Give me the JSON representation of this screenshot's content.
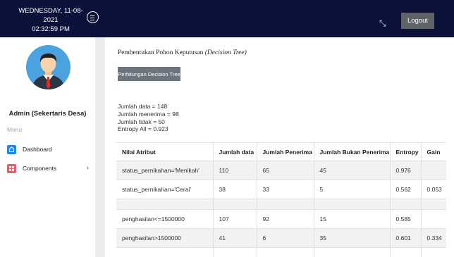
{
  "header": {
    "date": "WEDNESDAY, 11-08-2021",
    "time": "02:32:59 PM",
    "logout_label": "Logout"
  },
  "sidebar": {
    "user_name": "Admin (Sekertaris Desa)",
    "menu_label": "Menu",
    "items": [
      {
        "label": "Dashboard",
        "icon": "dashboard-icon"
      },
      {
        "label": "Components",
        "icon": "components-icon",
        "arrow": "›"
      }
    ]
  },
  "main": {
    "title": "Pembentukan Pohon Keputusan",
    "title_italic": "(Decision Tree)",
    "button_label": "Perhitungan Decision Tree",
    "stats": [
      "Jumlah data = 148",
      "Jumlah menerima = 98",
      "Jumlah tidak = 50",
      "Entropy All = 0.923"
    ],
    "table": {
      "headers": [
        "Nilai Atribut",
        "Jumlah data",
        "Jumlah Penerima",
        "Jumlah Bukan Penerima",
        "Entropy",
        "Gain"
      ],
      "rows": [
        [
          "status_pernikahan='Menikah'",
          "110",
          "65",
          "45",
          "0.976",
          ""
        ],
        [
          "status_pernikahan='Cerai'",
          "38",
          "33",
          "5",
          "0.562",
          "0.053"
        ],
        [
          "",
          "",
          "",
          "",
          "",
          ""
        ],
        [
          "penghasilan<=1500000",
          "107",
          "92",
          "15",
          "0.585",
          ""
        ],
        [
          "penghasilan>1500000",
          "41",
          "6",
          "35",
          "0.601",
          "0.334"
        ],
        [
          "",
          "",
          "",
          "",
          "",
          ""
        ]
      ]
    }
  },
  "colors": {
    "topbar": "#0b1139",
    "dashboard_icon": "#1e88e5",
    "components_icon": "#ef5b63",
    "button": "#6c757d",
    "logout": "#5f6368"
  }
}
